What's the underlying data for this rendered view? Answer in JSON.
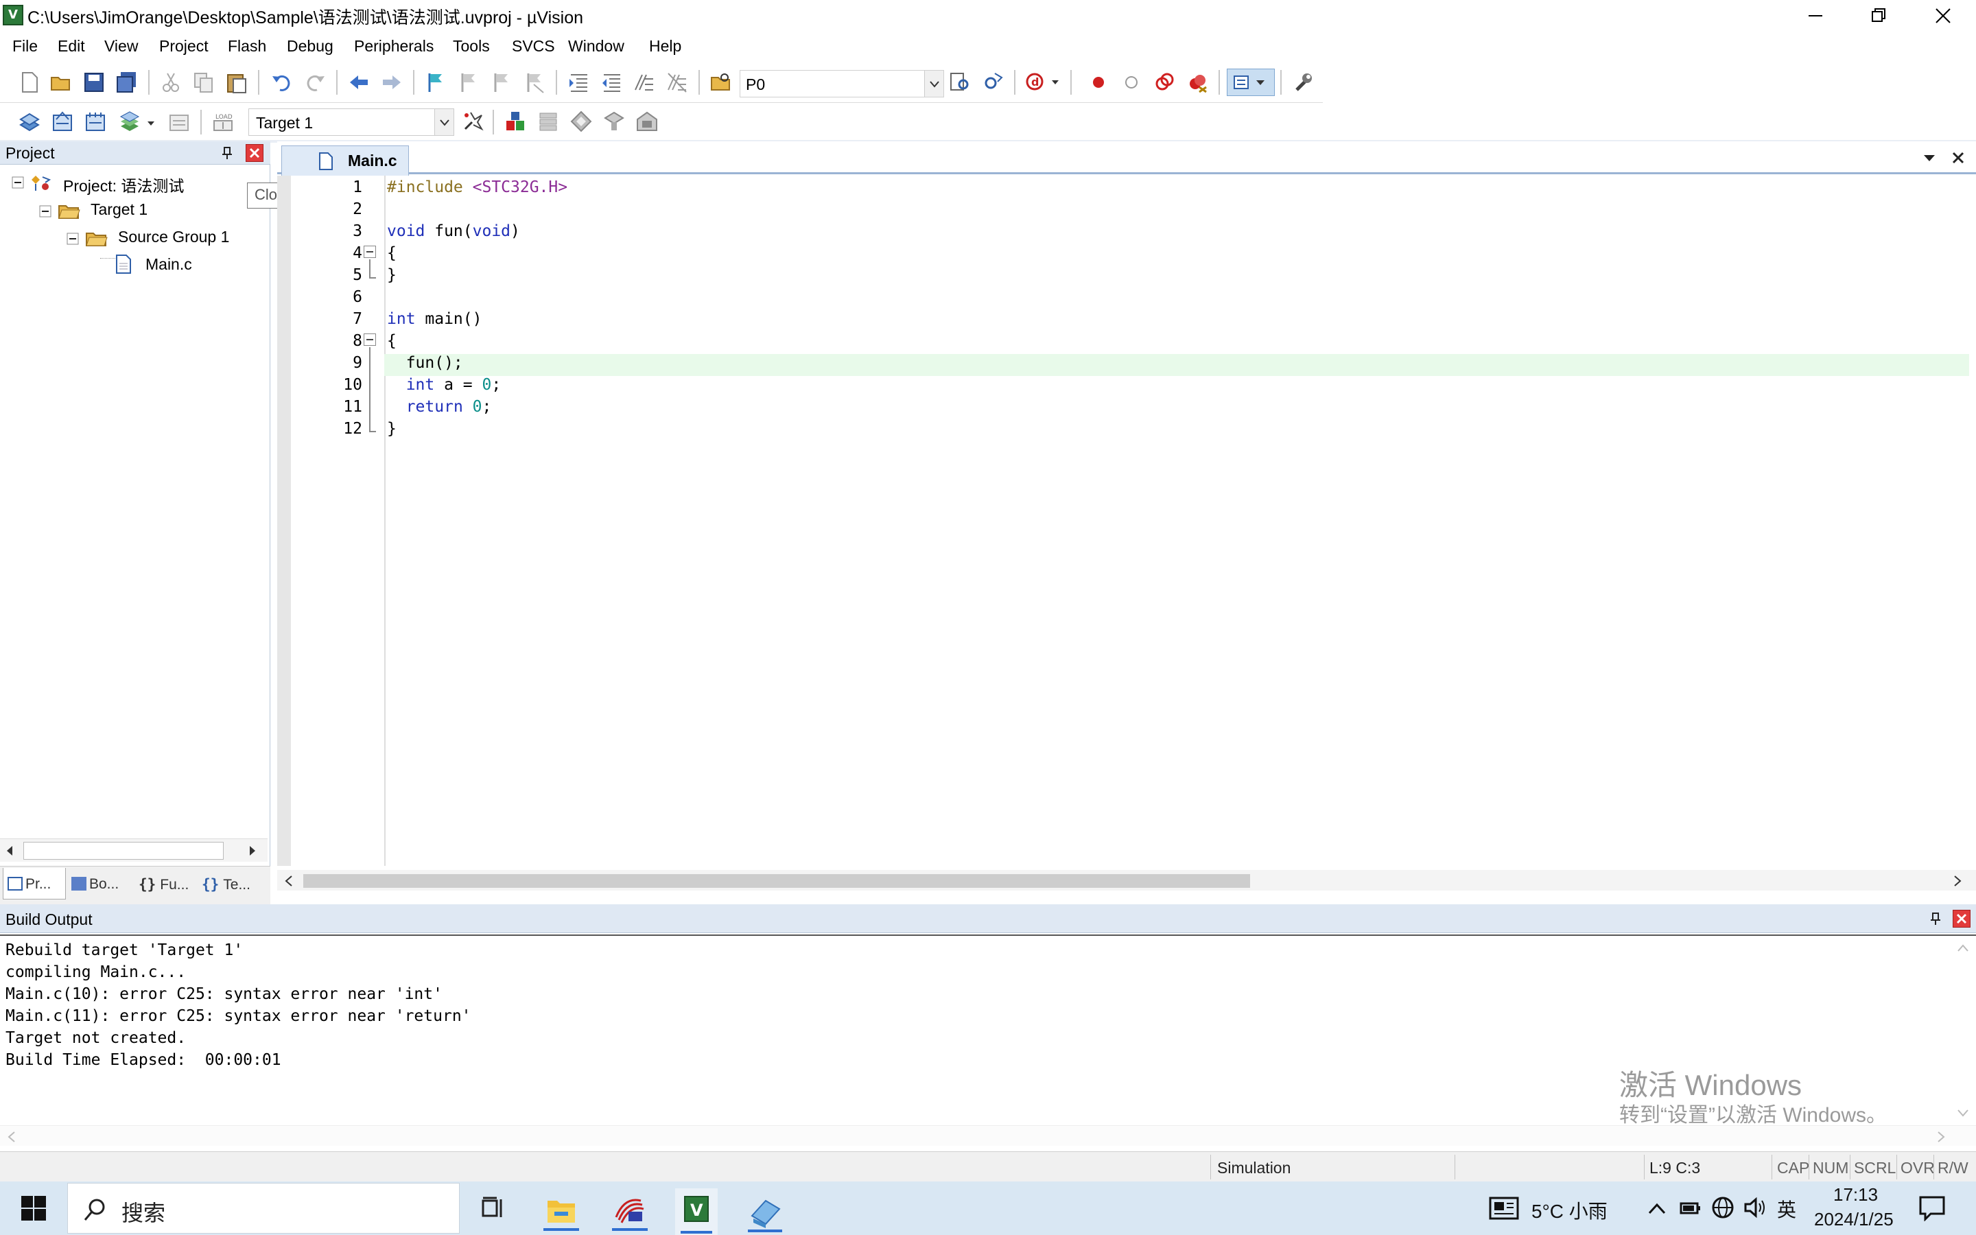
{
  "window": {
    "title": "C:\\Users\\JimOrange\\Desktop\\Sample\\语法测试\\语法测试.uvproj - µVision",
    "app_icon_glyph": "V"
  },
  "menu": [
    "File",
    "Edit",
    "View",
    "Project",
    "Flash",
    "Debug",
    "Peripherals",
    "Tools",
    "SVCS",
    "Window",
    "Help"
  ],
  "toolbar": {
    "target_value": "Target 1",
    "combo_value": "P0"
  },
  "project_panel": {
    "title": "Project",
    "tooltip": "Close",
    "tree": [
      {
        "label": "Project: 语法测试",
        "level": 0
      },
      {
        "label": "Target 1",
        "level": 1
      },
      {
        "label": "Source Group 1",
        "level": 2
      },
      {
        "label": "Main.c",
        "level": 3
      }
    ],
    "tabs": [
      "Pr...",
      "Bo...",
      "Fu...",
      "Te..."
    ]
  },
  "editor": {
    "tab_label": "Main.c",
    "lines": [
      {
        "n": "1",
        "code": "#include <STC32G.H>"
      },
      {
        "n": "2",
        "code": ""
      },
      {
        "n": "3",
        "code": "void fun(void)"
      },
      {
        "n": "4",
        "code": "{"
      },
      {
        "n": "5",
        "code": "}"
      },
      {
        "n": "6",
        "code": ""
      },
      {
        "n": "7",
        "code": "int main()"
      },
      {
        "n": "8",
        "code": "{"
      },
      {
        "n": "9",
        "code": "  fun();"
      },
      {
        "n": "10",
        "code": "  int a = 0;"
      },
      {
        "n": "11",
        "code": "  return 0;"
      },
      {
        "n": "12",
        "code": "}"
      }
    ]
  },
  "build_output": {
    "title": "Build Output",
    "lines": [
      "Rebuild target 'Target 1'",
      "compiling Main.c...",
      "Main.c(10): error C25: syntax error near 'int'",
      "Main.c(11): error C25: syntax error near 'return'",
      "Target not created.",
      "Build Time Elapsed:  00:00:01"
    ],
    "watermark_line1": "激活 Windows",
    "watermark_line2": "转到“设置”以激活 Windows。"
  },
  "status": {
    "mode": "Simulation",
    "position": "L:9 C:3",
    "indicators": [
      "CAP",
      "NUM",
      "SCRL",
      "OVR",
      "R/W"
    ]
  },
  "taskbar": {
    "search_placeholder": "搜索",
    "weather": "5°C 小雨",
    "ime": "英",
    "time": "17:13",
    "date": "2024/1/25"
  },
  "colors": {
    "keyword": "#1f2fb8",
    "preprocessor": "#8a7020",
    "include_path": "#8b2b95",
    "number": "#0b8f8a",
    "current_line": "#e8faea",
    "panel_header": "#dfe8f3",
    "taskbar": "#d9e7f3"
  }
}
